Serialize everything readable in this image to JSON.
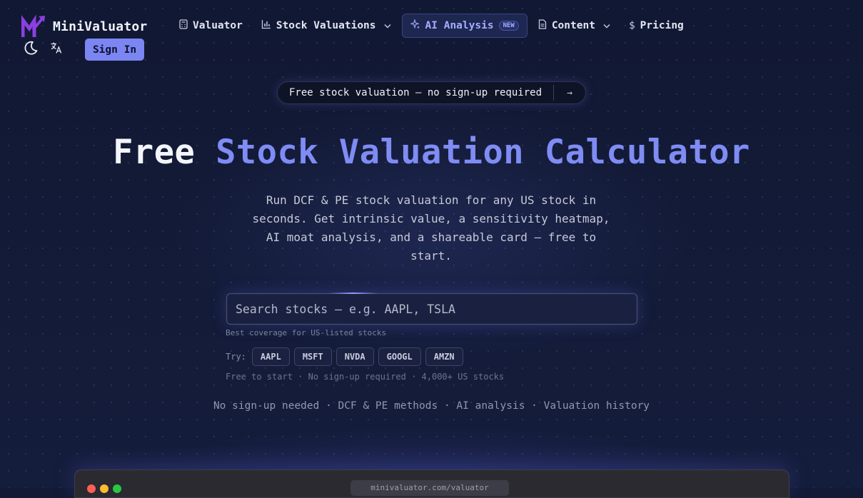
{
  "brand": {
    "name": "MiniValuator"
  },
  "nav": {
    "valuator": "Valuator",
    "stock_valuations": "Stock Valuations",
    "ai_analysis": "AI Analysis",
    "ai_badge": "NEW",
    "content": "Content",
    "pricing": "Pricing"
  },
  "header": {
    "sign_in": "Sign In"
  },
  "announcement": {
    "text": "Free stock valuation — no sign-up required",
    "arrow": "→"
  },
  "hero": {
    "title_plain": "Free ",
    "title_accent": "Stock Valuation Calculator",
    "subtitle": "Run DCF & PE stock valuation for any US stock in seconds. Get intrinsic value, a sensitivity heatmap, AI moat analysis, and a shareable card — free to start."
  },
  "search": {
    "placeholder": "Search stocks — e.g. AAPL, TSLA",
    "hint": "Best coverage for US-listed stocks"
  },
  "try": {
    "label": "Try:",
    "tickers": [
      "AAPL",
      "MSFT",
      "NVDA",
      "GOOGL",
      "AMZN"
    ]
  },
  "free_note": "Free to start · No sign-up required · 4,000+ US stocks",
  "features": "No sign-up needed · DCF & PE methods · AI analysis · Valuation history",
  "preview": {
    "url": "minivaluator.com/valuator"
  },
  "colors": {
    "background": "#131a36",
    "accent": "#7f8cf4",
    "logo": "#8b3fe0",
    "sign_in_bg": "#7b86f2"
  },
  "icons": {
    "theme_toggle": "moon-icon",
    "language": "translate-icon",
    "valuator": "calculator-icon",
    "stock_valuations": "bar-chart-icon",
    "ai_analysis": "sparkles-icon",
    "content": "document-icon",
    "pricing": "dollar-icon"
  }
}
